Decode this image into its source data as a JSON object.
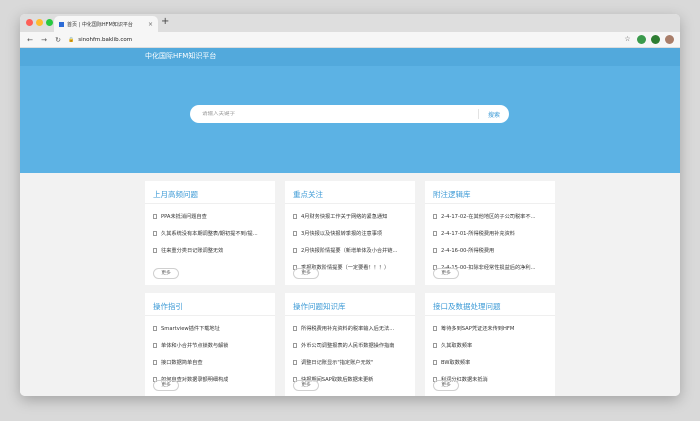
{
  "browser": {
    "tab_title": "首页 | 中化国际HFM知识平台",
    "tab_close": "×",
    "new_tab": "+",
    "url": "sinohfm.baklib.com",
    "back": "←",
    "forward": "→",
    "reload": "↻",
    "star": "☆"
  },
  "site": {
    "name": "中化国际HFM知识平台",
    "search_placeholder": "请输入关键字",
    "search_button": "搜索"
  },
  "cards": [
    {
      "title": "上月高频问题",
      "more": "更多",
      "items": [
        "PPA未抵消问题自查",
        "久其系统没有本期调整表/期初提不到/提...",
        "往来重分类日记账调整无效"
      ]
    },
    {
      "title": "重点关注",
      "more": "更多",
      "items": [
        "4月财务快报工作关于网络的紧急通知",
        "3月快报以及快报转季报的注意事项",
        "2月快报阶情提要（新增单体及小合并链...",
        "季报取数阶情提要（一定要看！！！）"
      ]
    },
    {
      "title": "附注逻辑库",
      "more": "更多",
      "items": [
        "2-4-17-02-在其他地区的子公司税率不...",
        "2-4-17-01-所得税费用补充资料",
        "2-4-16-00-所得税费用",
        "2-4-15-00-扣除非经常性损益后的净利..."
      ]
    },
    {
      "title": "操作指引",
      "more": "更多",
      "items": [
        "Smartview插件下载地址",
        "单体和小合并节点锁数与解锁",
        "接口数据简单自查",
        "如何自查对数据录额明细构成"
      ]
    },
    {
      "title": "操作问题知识库",
      "more": "更多",
      "items": [
        "所得税费用补充资料的税率输入后无法...",
        "外币公司调整报表的人民币数据操作指南",
        "调整日记账显示\"指定账户无效\"",
        "快报期间SAP取数后数据未更新"
      ]
    },
    {
      "title": "接口及数据处理问题",
      "more": "更多",
      "items": [
        "筹待多到SAP凭证还未传到HFM",
        "久其取数频率",
        "BW取数频率",
        "利润分红数据未抵消"
      ]
    }
  ]
}
